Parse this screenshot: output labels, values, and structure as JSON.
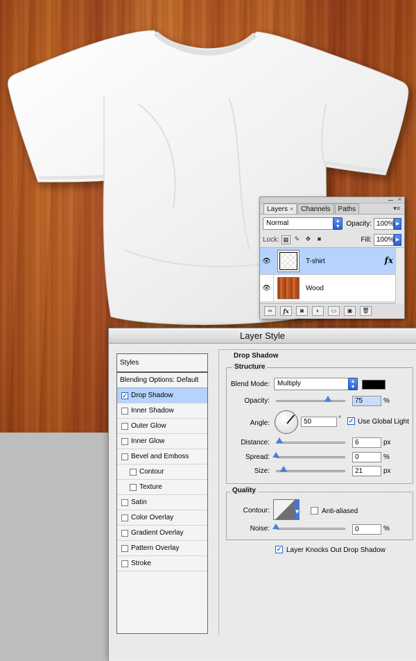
{
  "layers_panel": {
    "tabs": [
      {
        "label": "Layers"
      },
      {
        "label": "Channels"
      },
      {
        "label": "Paths"
      }
    ],
    "close_glyph": "×",
    "blend_mode": "Normal",
    "opacity_label": "Opacity:",
    "opacity_value": "100%",
    "lock_label": "Lock:",
    "fill_label": "Fill:",
    "fill_value": "100%",
    "layers": [
      {
        "name": "T-shirt",
        "selected": true,
        "has_fx": true,
        "fx_label": "fx"
      },
      {
        "name": "Wood",
        "selected": false,
        "has_fx": false
      }
    ],
    "bottom_icons": [
      "link-icon",
      "fx-icon",
      "mask-icon",
      "adjustment-icon",
      "folder-icon",
      "new-layer-icon",
      "trash-icon"
    ],
    "fx_button": "fx"
  },
  "layer_style": {
    "title": "Layer Style",
    "styles_list": {
      "header": "Styles",
      "blending_options": "Blending Options: Default",
      "items": [
        {
          "label": "Drop Shadow",
          "checked": true,
          "selected": true,
          "indent": false
        },
        {
          "label": "Inner Shadow",
          "checked": false,
          "selected": false,
          "indent": false
        },
        {
          "label": "Outer Glow",
          "checked": false,
          "selected": false,
          "indent": false
        },
        {
          "label": "Inner Glow",
          "checked": false,
          "selected": false,
          "indent": false
        },
        {
          "label": "Bevel and Emboss",
          "checked": false,
          "selected": false,
          "indent": false
        },
        {
          "label": "Contour",
          "checked": false,
          "selected": false,
          "indent": true
        },
        {
          "label": "Texture",
          "checked": false,
          "selected": false,
          "indent": true
        },
        {
          "label": "Satin",
          "checked": false,
          "selected": false,
          "indent": false
        },
        {
          "label": "Color Overlay",
          "checked": false,
          "selected": false,
          "indent": false
        },
        {
          "label": "Gradient Overlay",
          "checked": false,
          "selected": false,
          "indent": false
        },
        {
          "label": "Pattern Overlay",
          "checked": false,
          "selected": false,
          "indent": false
        },
        {
          "label": "Stroke",
          "checked": false,
          "selected": false,
          "indent": false
        }
      ]
    },
    "panel_title": "Drop Shadow",
    "structure": {
      "title": "Structure",
      "blend_mode_label": "Blend Mode:",
      "blend_mode_value": "Multiply",
      "shadow_color": "#000000",
      "opacity_label": "Opacity:",
      "opacity_value": "75",
      "opacity_fraction": 0.75,
      "percent_unit": "%",
      "angle_label": "Angle:",
      "angle_value": "50",
      "degree_unit": "°",
      "use_global_light_label": "Use Global Light",
      "use_global_light": true,
      "distance_label": "Distance:",
      "distance_value": "6",
      "px_unit": "px",
      "spread_label": "Spread:",
      "spread_value": "0",
      "size_label": "Size:",
      "size_value": "21"
    },
    "quality": {
      "title": "Quality",
      "contour_label": "Contour:",
      "anti_aliased_label": "Anti-aliased",
      "anti_aliased": false,
      "noise_label": "Noise:",
      "noise_value": "0"
    },
    "knocks_out_label": "Layer Knocks Out Drop Shadow",
    "knocks_out": true
  }
}
